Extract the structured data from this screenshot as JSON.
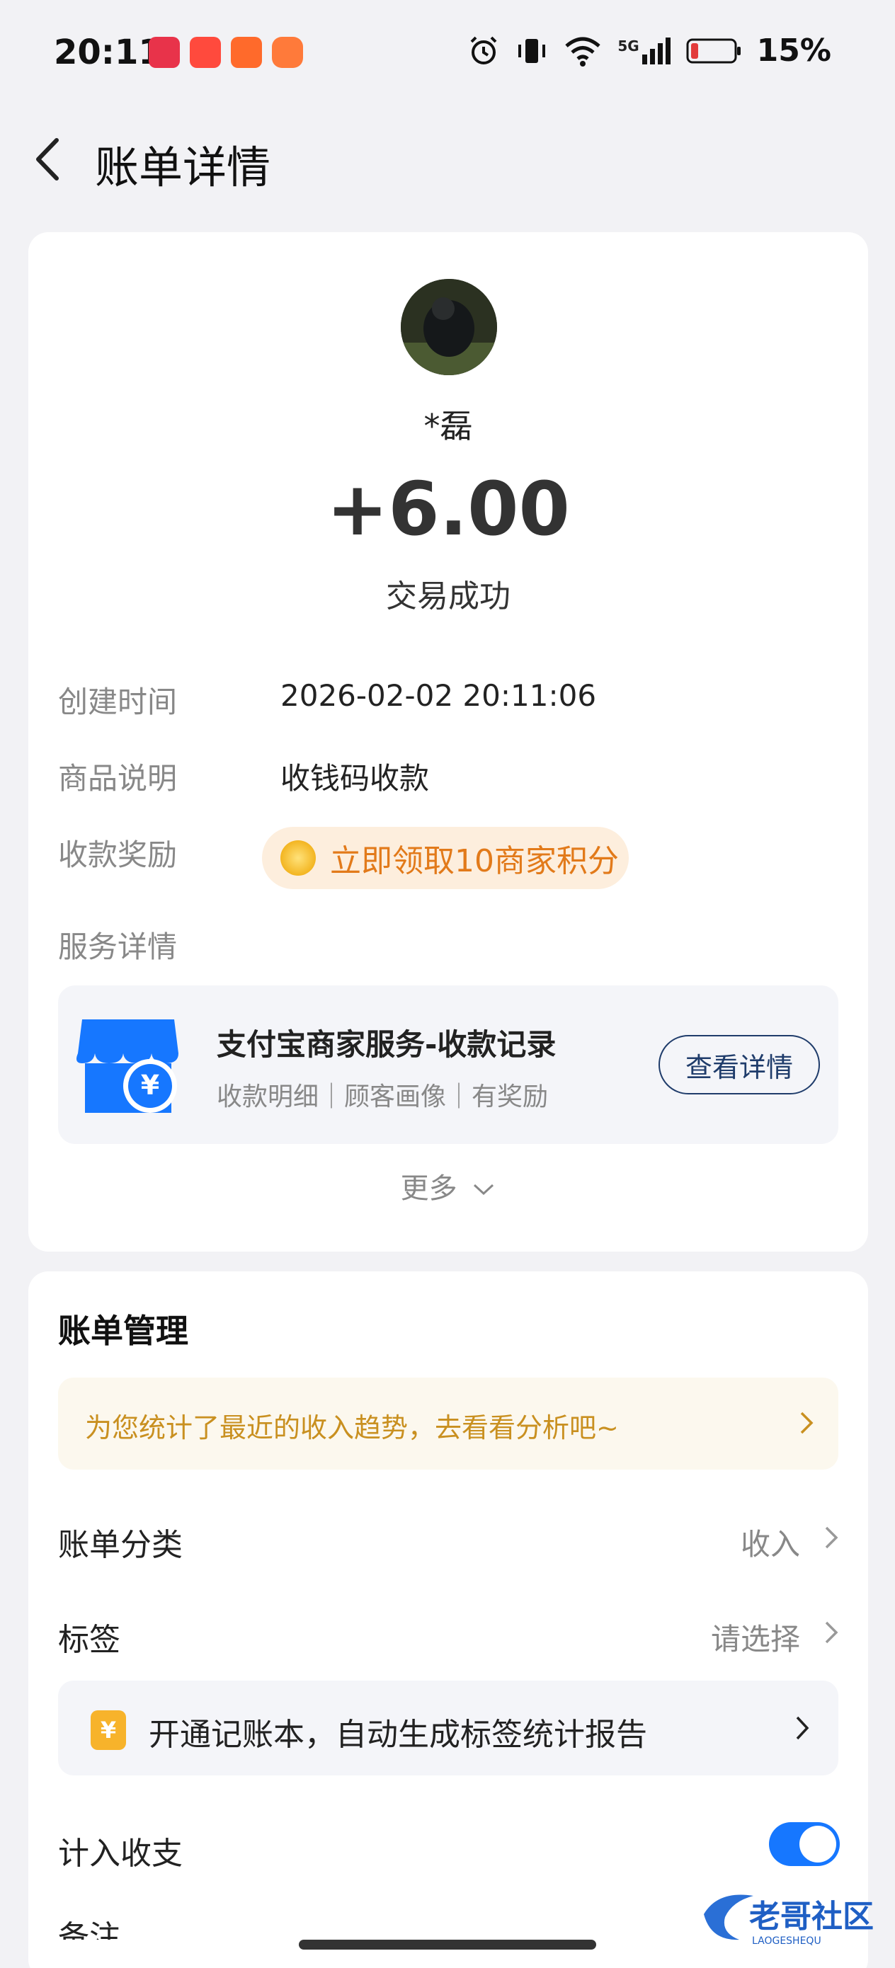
{
  "status_bar": {
    "time": "20:11",
    "network": "5G",
    "battery_percent": "15%",
    "battery_color": "#e23b3b"
  },
  "header": {
    "title": "账单详情",
    "back_icon": "chevron-left-icon"
  },
  "transaction": {
    "name": "*磊",
    "amount": "+6.00",
    "status": "交易成功",
    "created_label": "创建时间",
    "created_value": "2026-02-02 20:11:06",
    "product_label": "商品说明",
    "product_value": "收钱码收款",
    "reward_label": "收款奖励",
    "reward_text": "立即领取10商家积分",
    "service_label": "服务详情"
  },
  "service": {
    "title": "支付宝商家服务-收款记录",
    "subtitle": "收款明细｜顾客画像｜有奖励",
    "button": "查看详情",
    "more": "更多"
  },
  "bill_management": {
    "title": "账单管理",
    "tip": "为您统计了最近的收入趋势，去看看分析吧~",
    "category_label": "账单分类",
    "category_value": "收入",
    "tag_label": "标签",
    "tag_value": "请选择",
    "book_text": "开通记账本，自动生成标签统计报告",
    "include_label": "计入收支",
    "include_on": true,
    "note_label": "备注"
  },
  "colors": {
    "accent": "#1677ff",
    "reward": "#e27a1a",
    "tip": "#c99020"
  },
  "watermark": {
    "text": "老哥社区",
    "sub": "LAOGESHEQU"
  }
}
